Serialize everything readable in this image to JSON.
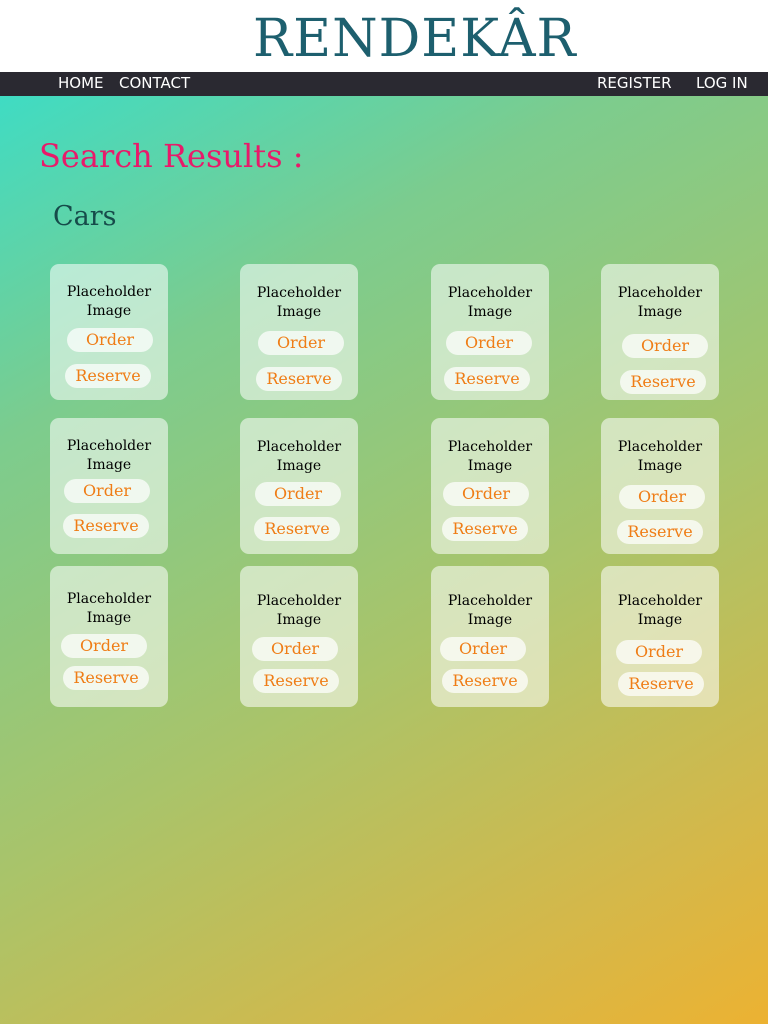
{
  "header": {
    "logo": "RENDEKÂR"
  },
  "nav": {
    "home": "HOME",
    "contact": "CONTACT",
    "register": "REGISTER",
    "login": "LOG IN"
  },
  "main": {
    "title": "Search Results :",
    "section": "Cars",
    "cards": [
      {
        "image": "Placeholder Image",
        "order": "Order",
        "reserve": "Reserve"
      },
      {
        "image": "Placeholder Image",
        "order": "Order",
        "reserve": "Reserve"
      },
      {
        "image": "Placeholder Image",
        "order": "Order",
        "reserve": "Reserve"
      },
      {
        "image": "Placeholder Image",
        "order": "Order",
        "reserve": "Reserve"
      },
      {
        "image": "Placeholder Image",
        "order": "Order",
        "reserve": "Reserve"
      },
      {
        "image": "Placeholder Image",
        "order": "Order",
        "reserve": "Reserve"
      },
      {
        "image": "Placeholder Image",
        "order": "Order",
        "reserve": "Reserve"
      },
      {
        "image": "Placeholder Image",
        "order": "Order",
        "reserve": "Reserve"
      },
      {
        "image": "Placeholder Image",
        "order": "Order",
        "reserve": "Reserve"
      },
      {
        "image": "Placeholder Image",
        "order": "Order",
        "reserve": "Reserve"
      },
      {
        "image": "Placeholder Image",
        "order": "Order",
        "reserve": "Reserve"
      },
      {
        "image": "Placeholder Image",
        "order": "Order",
        "reserve": "Reserve"
      }
    ]
  },
  "colors": {
    "logo": "#1d5f6e",
    "navbar": "#2a2931",
    "title": "#e81a6a",
    "section": "#164b4a",
    "button_text": "#ef7d16",
    "gradient_start": "#2ee0d2",
    "gradient_end": "#ecb232"
  }
}
